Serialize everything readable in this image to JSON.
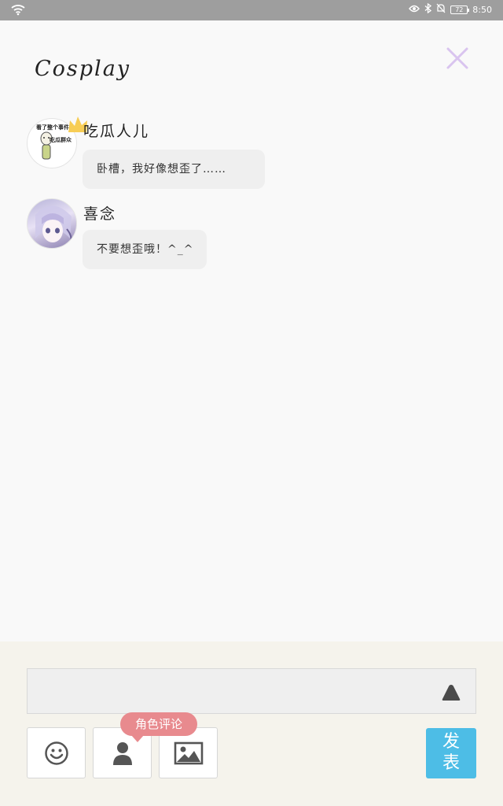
{
  "status_bar": {
    "battery": "72",
    "time": "8:50"
  },
  "header": {
    "title": "Cosplay"
  },
  "messages": [
    {
      "name": "吃瓜人儿",
      "text": "卧槽，我好像想歪了……",
      "avatar_text_top": "看了整个事件",
      "avatar_text_bottom": "吃瓜群众"
    },
    {
      "name": "喜念",
      "text": "不要想歪哦！^_^"
    }
  ],
  "composer": {
    "input_value": "",
    "tooltip": "角色评论",
    "post_label_1": "发",
    "post_label_2": "表"
  },
  "colors": {
    "accent": "#4dbde6",
    "tooltip": "#e88a8e",
    "close_icon": "#d9c4ef"
  },
  "icons": [
    "wifi-icon",
    "eye-icon",
    "bluetooth-icon",
    "mute-icon",
    "close-icon",
    "crown-icon",
    "send-icon",
    "emoji-icon",
    "person-icon",
    "image-icon"
  ]
}
